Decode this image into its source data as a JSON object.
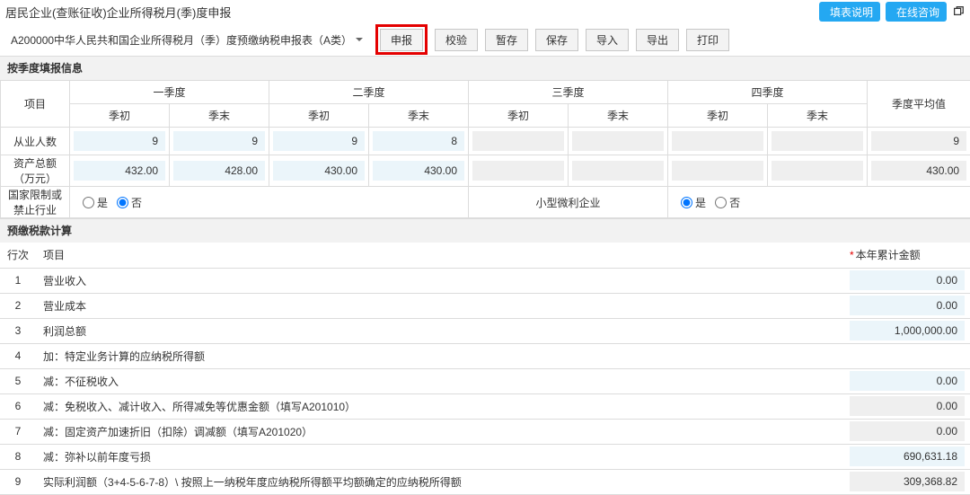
{
  "header": {
    "title": "居民企业(查账征收)企业所得税月(季)度申报",
    "instr_btn": "填表说明",
    "online_btn": "在线咨询"
  },
  "toolbar": {
    "form_name": "A200000中华人民共和国企业所得税月（季）度预缴纳税申报表（A类）",
    "declare": "申报",
    "validate": "校验",
    "save_draft": "暂存",
    "save": "保存",
    "import": "导入",
    "export": "导出",
    "print": "打印"
  },
  "quarter_section": {
    "title": "按季度填报信息",
    "col_project": "项目",
    "q1": "一季度",
    "q2": "二季度",
    "q3": "三季度",
    "q4": "四季度",
    "avg": "季度平均值",
    "sub_start": "季初",
    "sub_end": "季末",
    "rows": {
      "employees": {
        "label": "从业人数",
        "q1s": "9",
        "q1e": "9",
        "q2s": "9",
        "q2e": "8",
        "avg": "9"
      },
      "assets": {
        "label": "资产总额（万元）",
        "q1s": "432.00",
        "q1e": "428.00",
        "q2s": "430.00",
        "q2e": "430.00",
        "avg": "430.00"
      },
      "restricted": {
        "label": "国家限制或禁止行业",
        "yes": "是",
        "no": "否"
      },
      "micro": {
        "label": "小型微利企业",
        "yes": "是",
        "no": "否"
      }
    }
  },
  "calc_section": {
    "title": "预缴税款计算",
    "col_row": "行次",
    "col_project": "项目",
    "col_amount": "本年累计金额"
  },
  "lines": [
    {
      "n": "1",
      "label": "营业收入",
      "amt": "0.00",
      "tone": "blue"
    },
    {
      "n": "2",
      "label": "营业成本",
      "amt": "0.00",
      "tone": "blue"
    },
    {
      "n": "3",
      "label": "利润总额",
      "amt": "1,000,000.00",
      "tone": "blue"
    },
    {
      "n": "4",
      "label": "加：特定业务计算的应纳税所得额",
      "amt": "",
      "tone": "blank"
    },
    {
      "n": "5",
      "label": "减：不征税收入",
      "amt": "0.00",
      "tone": "blue"
    },
    {
      "n": "6",
      "label": "减：免税收入、减计收入、所得减免等优惠金额（填写A201010）",
      "amt": "0.00",
      "tone": "grey"
    },
    {
      "n": "7",
      "label": "减：固定资产加速折旧（扣除）调减额（填写A201020）",
      "amt": "0.00",
      "tone": "grey"
    },
    {
      "n": "8",
      "label": "减：弥补以前年度亏损",
      "amt": "690,631.18",
      "tone": "blue"
    },
    {
      "n": "9",
      "label": "实际利润额（3+4-5-6-7-8）\\ 按照上一纳税年度应纳税所得额平均额确定的应纳税所得额",
      "amt": "309,368.82",
      "tone": "grey"
    }
  ]
}
